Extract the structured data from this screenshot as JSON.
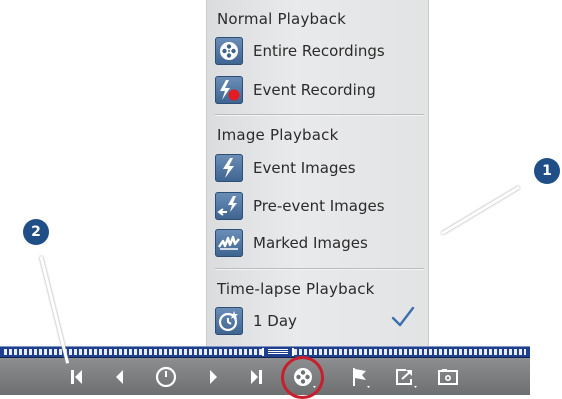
{
  "menu": {
    "normal_title": "Normal Playback",
    "entire_label": "Entire Recordings",
    "event_rec_label": "Event Recording",
    "image_title": "Image Playback",
    "event_images_label": "Event Images",
    "pre_event_label": "Pre-event Images",
    "marked_label": "Marked Images",
    "timelapse_title": "Time-lapse Playback",
    "one_day_label": "1 Day",
    "selected_item": "1 Day"
  },
  "callouts": {
    "one": "1",
    "two": "2"
  },
  "toolbar": {
    "buttons": [
      "skip-to-start",
      "previous",
      "live",
      "next",
      "skip-to-end",
      "playback-mode",
      "flag",
      "export",
      "snapshot"
    ],
    "highlighted": "playback-mode"
  },
  "colors": {
    "accent": "#3d638f",
    "highlight": "#c81e2d",
    "timeline": "#1e3f8e",
    "callout": "#1f4f86"
  }
}
